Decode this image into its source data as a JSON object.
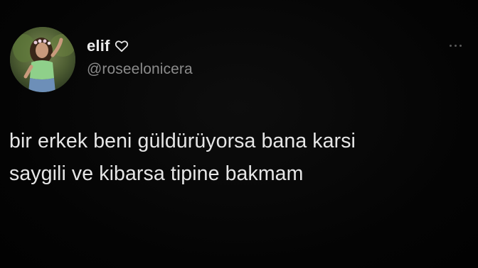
{
  "author": {
    "display_name": "elif",
    "handle": "@roseelonicera",
    "badge_icon": "heart-outline-icon"
  },
  "tweet": {
    "lines": [
      "bir erkek beni güldürüyorsa bana karsi",
      "saygili ve kibarsa tipine bakmam"
    ]
  },
  "menu": {
    "icon": "more-options-icon"
  },
  "colors": {
    "background": "#050505",
    "primary_text": "#e9e9e9",
    "secondary_text": "#8b8b8b"
  }
}
